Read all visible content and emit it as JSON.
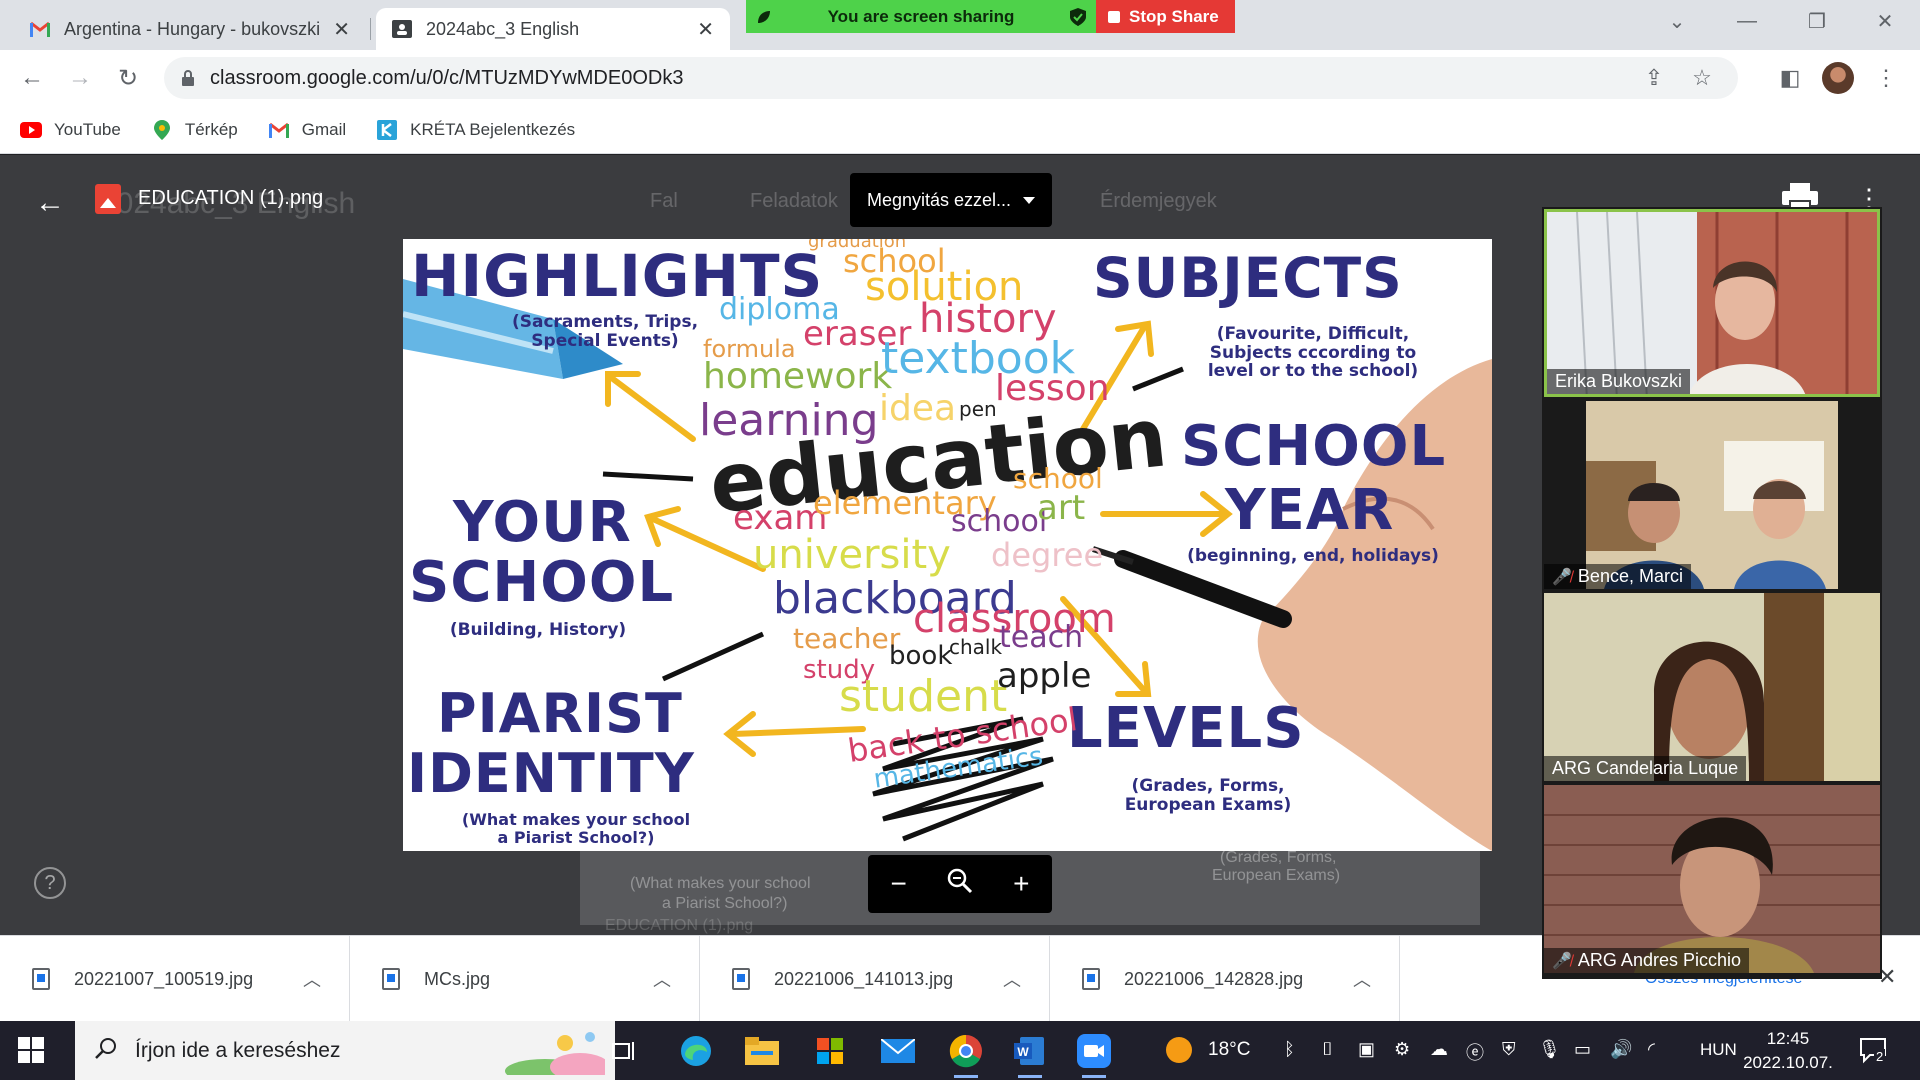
{
  "browser": {
    "tabs": [
      {
        "title": "Argentina - Hungary - bukovszki",
        "icon": "gmail-icon"
      },
      {
        "title": "2024abc_3 English",
        "icon": "classroom-icon"
      }
    ],
    "screen_share": {
      "message": "You are screen sharing",
      "stop_label": "Stop Share"
    },
    "url": "classroom.google.com/u/0/c/MTUzMDYwMDE0ODk3",
    "bookmarks": [
      {
        "label": "YouTube",
        "icon": "youtube-icon"
      },
      {
        "label": "Térkép",
        "icon": "maps-icon"
      },
      {
        "label": "Gmail",
        "icon": "gmail-icon"
      },
      {
        "label": "KRÉTA Bejelentkezés",
        "icon": "kreta-icon"
      }
    ]
  },
  "viewer": {
    "file_name": "EDUCATION (1).png",
    "open_with_label": "Megnyitás ezzel...",
    "background": {
      "class_title": "2024abc_3 English",
      "nav": [
        "Fal",
        "Feladatok",
        "Érdemjegyek"
      ],
      "caption_school": "(What makes your school",
      "caption_piarist": "a Piarist School?)",
      "caption_grades": "(Grades, Forms,",
      "caption_exams": "European Exams)",
      "file_caption": "EDUCATION (1).png"
    },
    "image": {
      "highlights": "HIGHLIGHTS",
      "highlights_sub": [
        "(Sacraments, Trips,",
        "Special Events)"
      ],
      "subjects": "SUBJECTS",
      "subjects_sub": [
        "(Favourite, Difficult,",
        "Subjects cccording to",
        "level or to the school)"
      ],
      "school_year": [
        "SCHOOL",
        "YEAR"
      ],
      "school_year_sub": "(beginning, end, holidays)",
      "your_school": [
        "YOUR",
        "SCHOOL"
      ],
      "your_school_sub": "(Building, History)",
      "piarist": [
        "PIARIST",
        "IDENTITY"
      ],
      "piarist_sub": [
        "(What makes your school",
        "a Piarist School?)"
      ],
      "levels": "LEVELS",
      "levels_sub": [
        "(Grades, Forms,",
        "European Exams)"
      ],
      "words": {
        "graduation": "graduation",
        "school1": "school",
        "diploma": "diploma",
        "solution": "solution",
        "formula": "formula",
        "eraser": "eraser",
        "history": "history",
        "homework": "homework",
        "textbook": "textbook",
        "learning": "learning",
        "idea": "idea",
        "pen": "pen",
        "lesson": "lesson",
        "education": "education",
        "exam": "exam",
        "elementary": "elementary",
        "school2": "school",
        "university": "university",
        "school3": "school",
        "art": "art",
        "blackboard": "blackboard",
        "degree": "degree",
        "teacher": "teacher",
        "classroom": "classroom",
        "study": "study",
        "book": "book",
        "chalk": "chalk",
        "teach": "teach",
        "student": "student",
        "apple": "apple",
        "back_to_school": "back to school",
        "mathematics": "mathematics"
      }
    },
    "zoom": {
      "out": "−",
      "in": "+"
    }
  },
  "participants": [
    {
      "name": "Erika Bukovszki",
      "muted": false
    },
    {
      "name": "Bence, Marci",
      "muted": true
    },
    {
      "name": "ARG Candelaria Luque",
      "muted": false
    },
    {
      "name": "ARG Andres Picchio",
      "muted": true
    }
  ],
  "downloads": {
    "items": [
      "20221007_100519.jpg",
      "MCs.jpg",
      "20221006_141013.jpg",
      "20221006_142828.jpg"
    ],
    "show_all": "Összes megjelenítése"
  },
  "taskbar": {
    "search_placeholder": "Írjon ide a kereséshez",
    "temperature": "18°C",
    "language": "HUN",
    "time": "12:45",
    "date": "2022.10.07.",
    "notification_count": "2"
  }
}
